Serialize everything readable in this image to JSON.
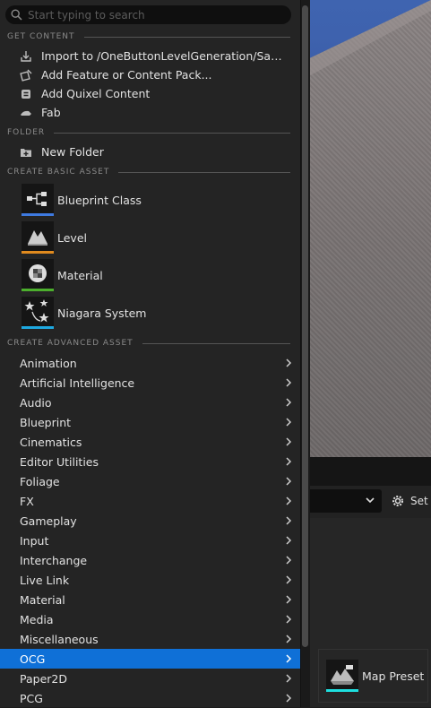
{
  "search": {
    "placeholder": "Start typing to search",
    "value": ""
  },
  "sections": {
    "get_content": "GET CONTENT",
    "folder": "FOLDER",
    "create_basic": "CREATE BASIC ASSET",
    "create_advanced": "CREATE ADVANCED ASSET"
  },
  "get_content_items": [
    {
      "label": "Import to /OneButtonLevelGeneration/Samples/Maps",
      "icon": "import-icon"
    },
    {
      "label": "Add Feature or Content Pack...",
      "icon": "content-pack-icon"
    },
    {
      "label": "Add Quixel Content",
      "icon": "quixel-icon"
    },
    {
      "label": "Fab",
      "icon": "fab-icon"
    }
  ],
  "folder_items": [
    {
      "label": "New Folder",
      "icon": "new-folder-icon"
    }
  ],
  "basic_assets": [
    {
      "label": "Blueprint Class",
      "icon": "blueprint-class-icon",
      "color": "#3e7ae0"
    },
    {
      "label": "Level",
      "icon": "level-icon",
      "color": "#e08a1e"
    },
    {
      "label": "Material",
      "icon": "material-icon",
      "color": "#4caf2d"
    },
    {
      "label": "Niagara System",
      "icon": "niagara-system-icon",
      "color": "#1ea8e0"
    }
  ],
  "advanced_assets": [
    {
      "label": "Animation"
    },
    {
      "label": "Artificial Intelligence"
    },
    {
      "label": "Audio"
    },
    {
      "label": "Blueprint"
    },
    {
      "label": "Cinematics"
    },
    {
      "label": "Editor Utilities"
    },
    {
      "label": "Foliage"
    },
    {
      "label": "FX"
    },
    {
      "label": "Gameplay"
    },
    {
      "label": "Input"
    },
    {
      "label": "Interchange"
    },
    {
      "label": "Live Link"
    },
    {
      "label": "Material"
    },
    {
      "label": "Media"
    },
    {
      "label": "Miscellaneous"
    },
    {
      "label": "OCG",
      "selected": true
    },
    {
      "label": "Paper2D"
    },
    {
      "label": "PCG"
    }
  ],
  "flyout": {
    "label": "Map Preset",
    "icon": "map-preset-icon",
    "color": "#1ee0e0"
  },
  "toolbar": {
    "settings_label": "Set"
  },
  "colors": {
    "selection": "#0f70d7",
    "menu_bg": "#242424"
  }
}
